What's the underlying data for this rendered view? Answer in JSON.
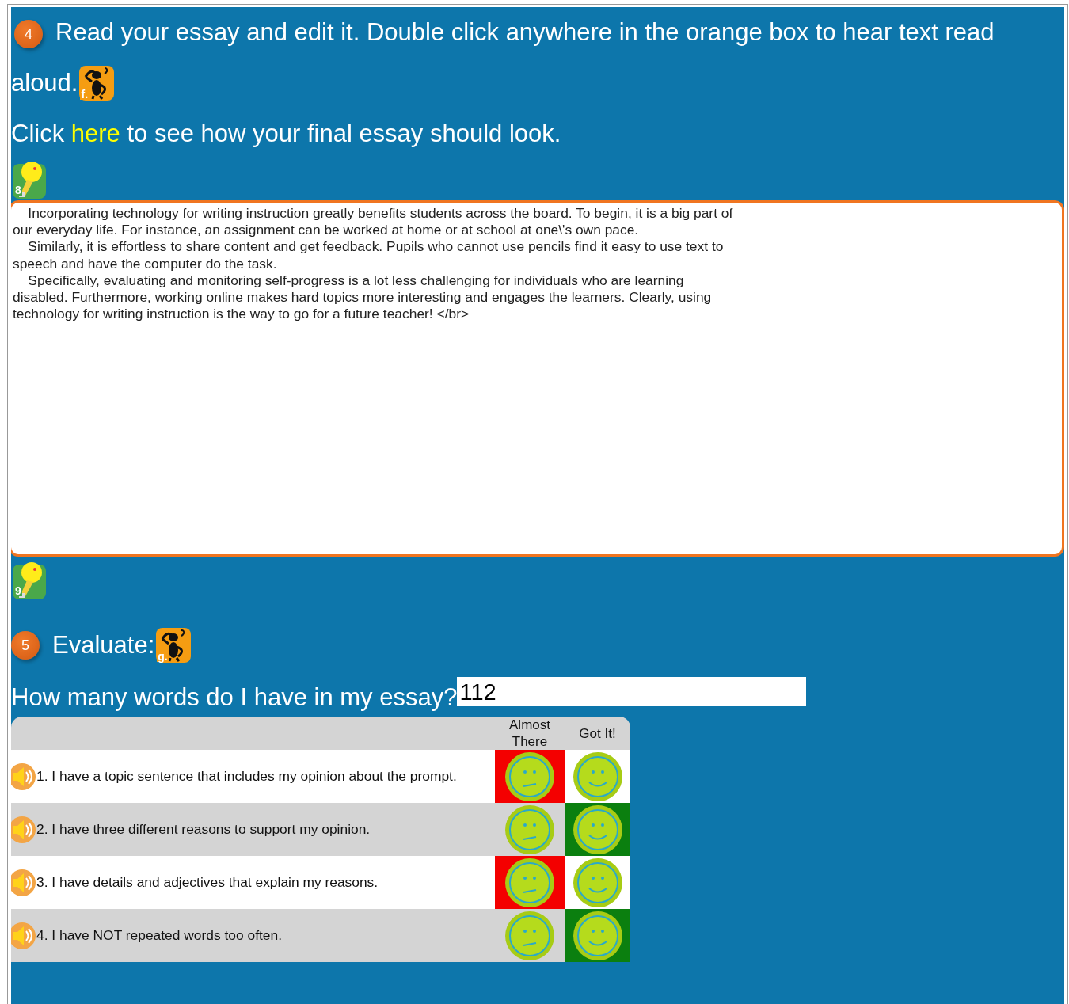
{
  "step4": {
    "number": "4",
    "instruction": "Read your essay and edit it. Double click anywhere in the orange box to hear text read",
    "instruction_end": "aloud.",
    "help_label": "f.",
    "link_line": {
      "before": "Click",
      "link": "here",
      "after": "to see how your final essay should look."
    },
    "hint_before": "8"
  },
  "essay": {
    "paragraphs": [
      "Incorporating technology for writing instruction greatly benefits students across the board. To begin, it is a big part of our everyday life. For instance, an assignment can be worked at home or at school at one\\'s own pace.",
      "Similarly, it is effortless to share content and get feedback. Pupils who cannot use pencils find it easy to use text to speech and have the computer do the task.",
      "Specifically, evaluating and monitoring self-progress is a lot less challenging for individuals who are learning disabled. Furthermore, working online makes hard topics more interesting and engages the learners. Clearly, using technology for writing instruction is the way to go for a future teacher! </br>"
    ]
  },
  "hint_after": "9",
  "step5": {
    "number": "5",
    "title": "Evaluate:",
    "help_label": "g."
  },
  "word_count": {
    "question": "How many words do I have in my essay?",
    "value": "112"
  },
  "checklist": {
    "columns": [
      "Almost There",
      "Got It!"
    ],
    "rows": [
      {
        "text": "1. I have a topic sentence that includes my opinion about the prompt.",
        "choices": [
          {
            "selected": true
          },
          {
            "selected": false
          }
        ]
      },
      {
        "text": "2. I have three different reasons to support my opinion.",
        "choices": [
          {
            "selected": false
          },
          {
            "selected": true
          }
        ]
      },
      {
        "text": "3. I have details and adjectives that explain my reasons.",
        "choices": [
          {
            "selected": true
          },
          {
            "selected": false
          }
        ]
      },
      {
        "text": "4. I have NOT repeated words too often.",
        "choices": [
          {
            "selected": false
          },
          {
            "selected": true
          }
        ]
      }
    ]
  }
}
